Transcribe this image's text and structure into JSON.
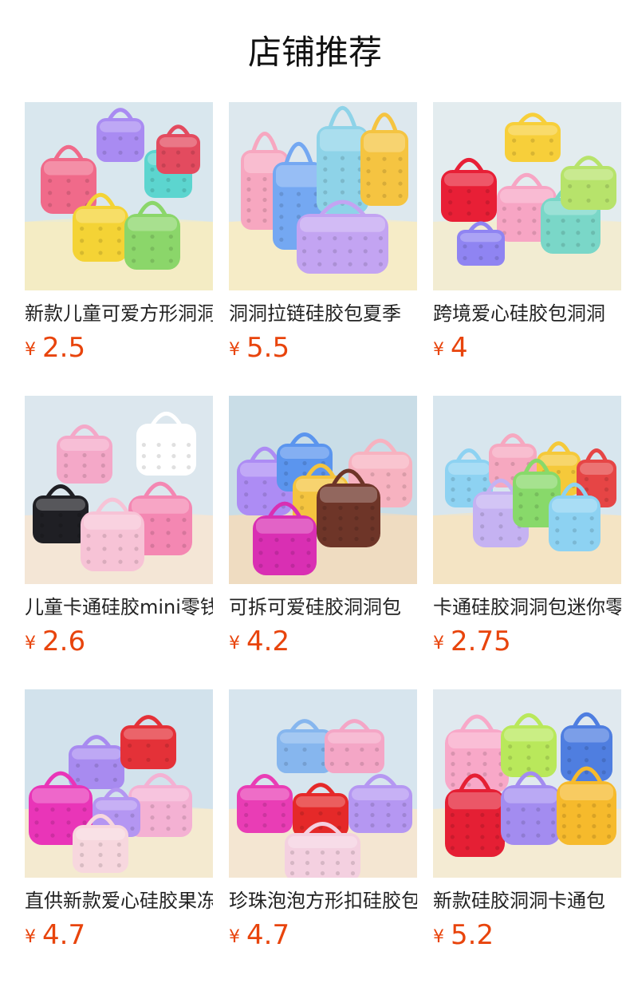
{
  "page": {
    "title": "店铺推荐",
    "currency_symbol": "¥"
  },
  "products": [
    {
      "name": "新款儿童可爱方形洞洞硅胶包",
      "price": "2.5",
      "image": "colorful-square-silicone-purses",
      "bg": "#d9e7ee",
      "floor": "#f4ecc4",
      "colors": [
        "#f06a8a",
        "#a98bf2",
        "#5cd5cf",
        "#f4d335",
        "#8bd66a",
        "#e34b5f"
      ]
    },
    {
      "name": "洞洞拉链硅胶包夏季",
      "price": "5.5",
      "image": "tall-silicone-zipper-bags",
      "bg": "#dde8ee",
      "floor": "#f6ecc7",
      "colors": [
        "#f7a7c0",
        "#74a8f2",
        "#8ed3e8",
        "#f5c441",
        "#c3a4f2"
      ]
    },
    {
      "name": "跨境爱心硅胶包洞洞",
      "price": "4",
      "image": "heart-silicone-bags",
      "bg": "#e3ecef",
      "floor": "#f2ecd2",
      "colors": [
        "#f7cf3a",
        "#e81f36",
        "#f7a5c4",
        "#7ad7c8",
        "#b7e36b",
        "#8f84f2"
      ]
    },
    {
      "name": "儿童卡通硅胶mini零钱包",
      "price": "2.6",
      "image": "cartoon-face-bags",
      "bg": "#dce7ee",
      "floor": "#f4e6d6",
      "colors": [
        "#f4a8c8",
        "#ffffff",
        "#1f1f24",
        "#f487b2",
        "#f7c3d6"
      ]
    },
    {
      "name": "可拆可爱硅胶洞洞包",
      "price": "4.2",
      "image": "cookie-silicone-bags",
      "bg": "#c9dde7",
      "floor": "#efdcc1",
      "colors": [
        "#ad8cf4",
        "#5b95ee",
        "#f4c43f",
        "#f7b2c0",
        "#6e3528",
        "#d92fb3"
      ]
    },
    {
      "name": "卡通硅胶洞洞包迷你零钱包",
      "price": "2.75",
      "image": "small-cartoon-purses",
      "bg": "#d8e6ee",
      "floor": "#f4e4c4",
      "colors": [
        "#8dd2f2",
        "#f6a8c0",
        "#f5c93a",
        "#e64545",
        "#c5b2f2",
        "#88d96a"
      ]
    },
    {
      "name": "直供新款爱心硅胶果冻包",
      "price": "4.7",
      "image": "pearl-handle-pop-bags",
      "bg": "#d2e2ec",
      "floor": "#f4ead0",
      "colors": [
        "#a88bf0",
        "#e43138",
        "#e935b8",
        "#f4b1d3",
        "#b496f2",
        "#f7d7de"
      ]
    },
    {
      "name": "珍珠泡泡方形扣硅胶包",
      "price": "4.7",
      "image": "pearl-pop-square-bags",
      "bg": "#d7e5ee",
      "floor": "#f3e6d2",
      "colors": [
        "#86b6ee",
        "#f4a6c6",
        "#e93db5",
        "#b597f2",
        "#e52929",
        "#f4d0e0"
      ]
    },
    {
      "name": "新款硅胶洞洞卡通包",
      "price": "5.2",
      "image": "square-cartoon-box-bags",
      "bg": "#e0e9ef",
      "floor": "#f3ebd3",
      "colors": [
        "#f8a8c8",
        "#b9e85b",
        "#4f7ee0",
        "#e51f34",
        "#a38cf0",
        "#f6ba2c"
      ]
    }
  ]
}
